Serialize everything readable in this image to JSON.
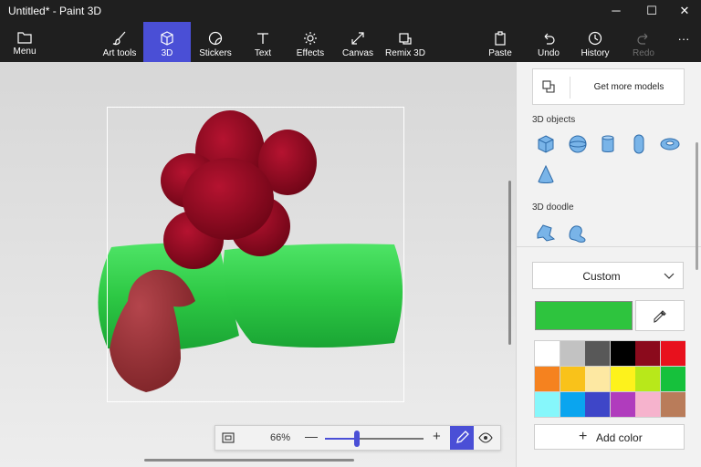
{
  "window": {
    "title": "Untitled* - Paint 3D",
    "minimize": "─",
    "maximize": "☐",
    "close": "✕"
  },
  "toolbar": {
    "menu": "Menu",
    "art_tools": "Art tools",
    "threeD": "3D",
    "stickers": "Stickers",
    "text": "Text",
    "effects": "Effects",
    "canvas": "Canvas",
    "remix": "Remix 3D",
    "paste": "Paste",
    "undo": "Undo",
    "history": "History",
    "redo": "Redo",
    "more": "···"
  },
  "zoom": {
    "percent": "66%",
    "minus": "—",
    "plus": "+",
    "level": 0.32
  },
  "panel": {
    "get_more": "Get more models",
    "objects_label": "3D objects",
    "objects": [
      "cube-icon",
      "sphere-icon",
      "cylinder-icon",
      "capsule-icon",
      "torus-icon",
      "cone-icon"
    ],
    "doodle_label": "3D doodle",
    "doodles": [
      "sharp-edge-doodle-icon",
      "soft-edge-doodle-icon"
    ],
    "material": "Custom",
    "current_color": "#2ec43e",
    "add_color": "Add color",
    "palette": [
      "#ffffff",
      "#c2c2c2",
      "#585858",
      "#000000",
      "#8b0a1c",
      "#e8111d",
      "#f5821f",
      "#f9c21a",
      "#fde8a2",
      "#fdf21c",
      "#b8e81a",
      "#16c13c",
      "#86f7fb",
      "#0aa5ef",
      "#3e46c8",
      "#b03cbd",
      "#f6b3cd",
      "#b97c5a"
    ]
  }
}
